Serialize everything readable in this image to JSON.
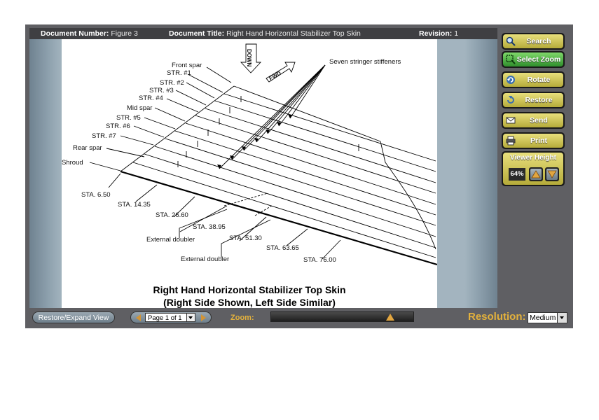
{
  "header": {
    "doc_number_label": "Document Number:",
    "doc_number": "Figure 3",
    "doc_title_label": "Document Title:",
    "doc_title": "Right Hand Horizontal Stabilizer Top Skin",
    "revision_label": "Revision:",
    "revision": "1"
  },
  "sidebar": {
    "search": "Search",
    "select_zoom": "Select Zoom",
    "rotate": "Rotate",
    "restore": "Restore",
    "send": "Send",
    "print": "Print",
    "viewer_height_label": "Viewer Height",
    "viewer_height_value": "64%"
  },
  "footer": {
    "restore_expand": "Restore/Expand View",
    "page_indicator": "Page 1 of 1",
    "zoom_label": "Zoom:",
    "zoom_level": 0.86,
    "resolution_label": "Resolution:",
    "resolution_value": "Medium"
  },
  "colors": {
    "frame": "#5f5f63",
    "button_gold": "#c9bf4e",
    "button_green": "#4caf3f",
    "accent_orange": "#e3b13c"
  },
  "drawing": {
    "callouts_left": [
      "Front spar",
      "STR. #1",
      "STR. #2",
      "STR. #3",
      "STR. #4",
      "Mid spar",
      "STR. #5",
      "STR. #6",
      "STR. #7",
      "Rear spar",
      "Shroud"
    ],
    "stations": [
      "STA. 6.50",
      "STA. 14.35",
      "STA. 26.60",
      "STA. 38.95",
      "STA. 51.30",
      "STA. 63.65",
      "STA. 76.00"
    ],
    "external_doubler_1": "External doubler",
    "external_doubler_2": "External doubler",
    "seven_stringer": "Seven stringer stiffeners",
    "down_label": "DOWN",
    "fwd_label": "FWD",
    "caption_line1": "Right Hand Horizontal Stabilizer Top Skin",
    "caption_line2": "(Right Side Shown, Left Side Similar)"
  }
}
